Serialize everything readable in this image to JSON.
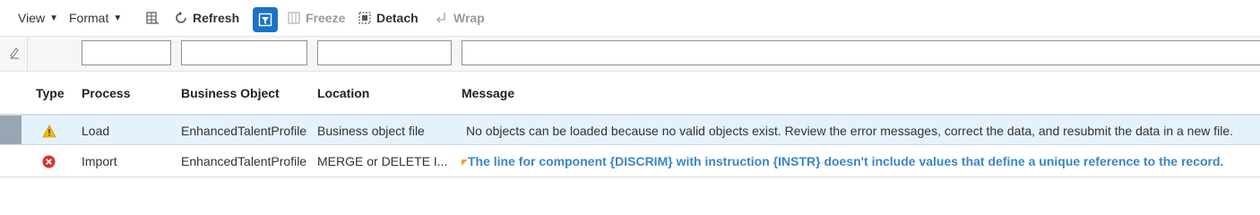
{
  "toolbar": {
    "view_label": "View",
    "format_label": "Format",
    "refresh_label": "Refresh",
    "freeze_label": "Freeze",
    "detach_label": "Detach",
    "wrap_label": "Wrap",
    "accent_color": "#1a73c8"
  },
  "filters": {
    "process": "",
    "business_object": "",
    "location": "",
    "message": ""
  },
  "columns": {
    "type": "Type",
    "process": "Process",
    "business_object": "Business Object",
    "location": "Location",
    "message": "Message"
  },
  "rows": [
    {
      "type_icon": "warning-icon",
      "process": "Load",
      "business_object": "EnhancedTalentProfile",
      "location": "Business object file",
      "message": "No objects can be loaded because no valid objects exist. Review the error messages, correct the data, and resubmit the data in a new file."
    },
    {
      "type_icon": "error-icon",
      "process": "Import",
      "business_object": "EnhancedTalentProfile",
      "location": "MERGE or DELETE I...",
      "message": "The line for component {DISCRIM} with instruction {INSTR} doesn't include values that define a unique reference to the record."
    }
  ],
  "colors": {
    "selected_row": "#e5f1fb",
    "warning": "#f5b800",
    "error": "#d9342b",
    "link": "#3a86c8"
  }
}
